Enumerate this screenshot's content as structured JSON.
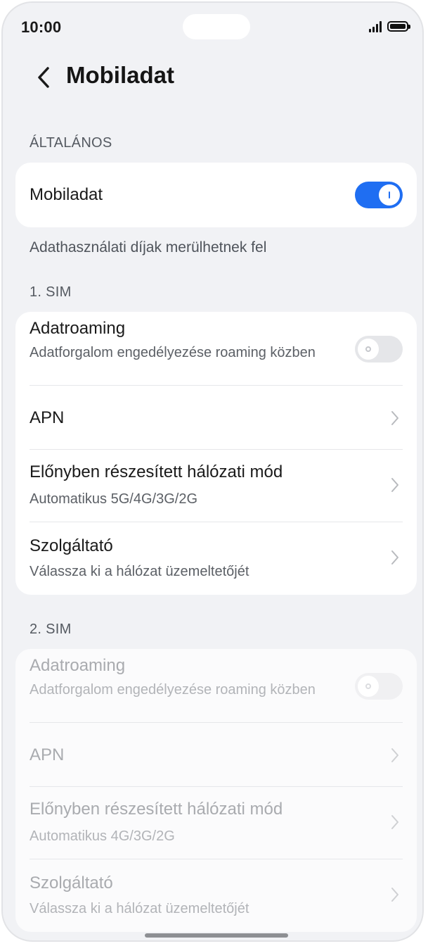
{
  "status_bar": {
    "time": "10:00",
    "icons": [
      "signal-icon",
      "battery-icon"
    ]
  },
  "header": {
    "title": "Mobiladat",
    "back_icon": "chevron-left-icon"
  },
  "general": {
    "section_label": "ÁLTALÁNOS",
    "mobile_data": {
      "label": "Mobiladat",
      "enabled": true
    },
    "note": "Adathasználati díjak merülhetnek fel"
  },
  "sim1": {
    "section_label": "1. SIM",
    "roaming": {
      "title": "Adatroaming",
      "subtitle": "Adatforgalom engedélyezése roaming közben",
      "enabled": false
    },
    "apn": {
      "title": "APN"
    },
    "network_mode": {
      "title": "Előnyben részesített hálózati mód",
      "subtitle": "Automatikus 5G/4G/3G/2G"
    },
    "carrier": {
      "title": "Szolgáltató",
      "subtitle": "Válassza ki a hálózat üzemeltetőjét"
    }
  },
  "sim2": {
    "section_label": "2. SIM",
    "roaming": {
      "title": "Adatroaming",
      "subtitle": "Adatforgalom engedélyezése roaming közben",
      "enabled": false
    },
    "apn": {
      "title": "APN"
    },
    "network_mode": {
      "title": "Előnyben részesített hálózati mód",
      "subtitle": "Automatikus 4G/3G/2G"
    },
    "carrier": {
      "title": "Szolgáltató",
      "subtitle": "Válassza ki a hálózat üzemeltetőjét"
    }
  },
  "colors": {
    "accent": "#1f6ef2",
    "background": "#f1f2f5",
    "card": "#ffffff"
  }
}
